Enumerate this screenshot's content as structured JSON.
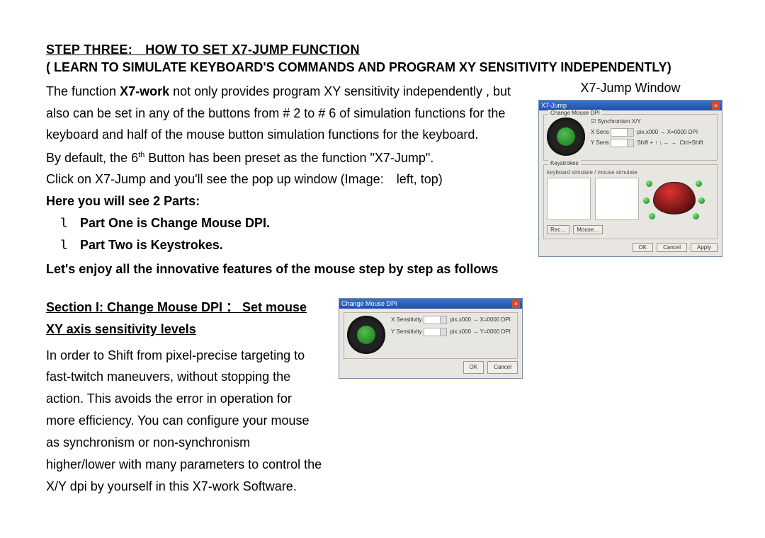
{
  "heading": "STEP THREE: HOW TO SET X7-JUMP FUNCTION",
  "subtitle": "( LEARN TO SIMULATE KEYBOARD'S COMMANDS AND PROGRAM XY SENSITIVITY INDEPENDENTLY)",
  "intro": {
    "pre": "The function ",
    "bold": "X7-work",
    "post": " not only provides program XY sensitivity independently , but also can be set in any of the buttons from # 2 to # 6 of simulation functions for the keyboard and half of the mouse button simulation functions for the keyboard."
  },
  "default_line_a": "By default, the 6",
  "default_line_sup": "th",
  "default_line_b": " Button has been preset as the function \"X7-Jump\".",
  "click_line": "Click on X7-Jump and you'll see the pop up window (Image: left, top)",
  "parts_header": "Here you will see 2 Parts:",
  "bullet_glyph": "l",
  "part_one": "Part One is Change Mouse DPI.",
  "part_two": "Part Two is Keystrokes.",
  "enjoy": "Let's enjoy all the innovative features of the mouse step by step as follows",
  "section_i": "Section I: Change Mouse DPI ： Set mouse XY axis sensitivity levels",
  "section_i_body": "In order to Shift from pixel-precise targeting to fast-twitch maneuvers, without stopping the action. This avoids the error in operation for more efficiency. You can configure your mouse as synchronism or non-synchronism higher/lower with many parameters to control the X/Y dpi by yourself in this X7-work Software.",
  "caption1": "X7-Jump Window",
  "shot1": {
    "title": "X7-Jump",
    "group1_legend": "Change Mouse DPI",
    "group2_legend": "Keystrokes",
    "btn_ok": "OK",
    "btn_cancel": "Cancel",
    "btn_apply": "Apply"
  },
  "shot2": {
    "title": "Change Mouse DPI",
    "btn_ok": "OK",
    "btn_cancel": "Cancel"
  }
}
